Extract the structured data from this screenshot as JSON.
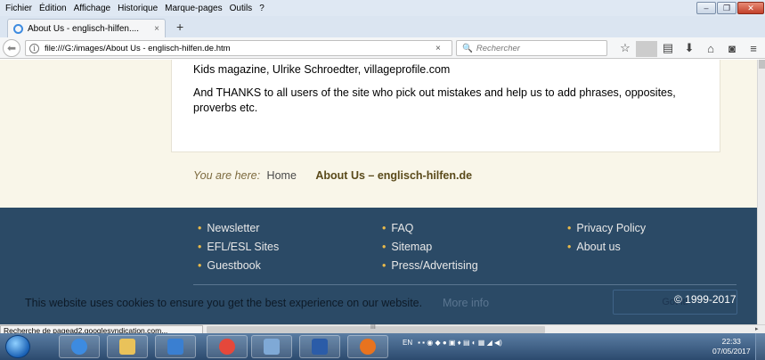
{
  "menu": [
    "Fichier",
    "Édition",
    "Affichage",
    "Historique",
    "Marque-pages",
    "Outils",
    "?"
  ],
  "tab": {
    "title": "About Us - englisch-hilfen....",
    "close": "×"
  },
  "newtab": "+",
  "nav": {
    "url": "file:///G:/images/About Us - englisch-hilfen.de.htm",
    "url_clear": "×",
    "search_placeholder": "Rechercher"
  },
  "content": {
    "para1": "Kids magazine, Ulrike Schroedter, villageprofile.com",
    "para2": "And THANKS to all users of the site who pick out mistakes and help us to add phrases, opposites, proverbs etc.",
    "breadcrumb": {
      "prefix": "You are here:",
      "home": "Home",
      "current": "About Us – englisch-hilfen.de"
    }
  },
  "footer": {
    "col1": [
      "Newsletter",
      "EFL/ESL Sites",
      "Guestbook"
    ],
    "col2": [
      "FAQ",
      "Sitemap",
      "Press/Advertising"
    ],
    "col3": [
      "Privacy Policy",
      "About us"
    ],
    "cookie_text": "This website uses cookies to ensure you get the best experience on our website.",
    "cookie_link": "More info",
    "cookie_button": "Got it!",
    "copyright": "© 1999-2017"
  },
  "status": {
    "text": "Recherche de pagead2.googlesyndication.com...",
    "grip": "III"
  },
  "taskbar": {
    "apps": [
      {
        "name": "internet-explorer",
        "color": "#3d8be0"
      },
      {
        "name": "file-explorer",
        "color": "#e9c25a"
      },
      {
        "name": "media-player",
        "color": "#3a7fd1"
      },
      {
        "name": "chrome",
        "color": "#e5483b"
      },
      {
        "name": "app-window",
        "color": "#7fa9d6"
      },
      {
        "name": "word",
        "color": "#2b5ca8"
      },
      {
        "name": "firefox",
        "color": "#e8731f"
      }
    ],
    "tray_lang": "EN",
    "clock_time": "22:33",
    "clock_date": "07/05/2017"
  },
  "colors": {
    "footer_bg": "#2b4a66",
    "content_bg": "#f9f6e9",
    "bullet": "#e8b94a"
  }
}
